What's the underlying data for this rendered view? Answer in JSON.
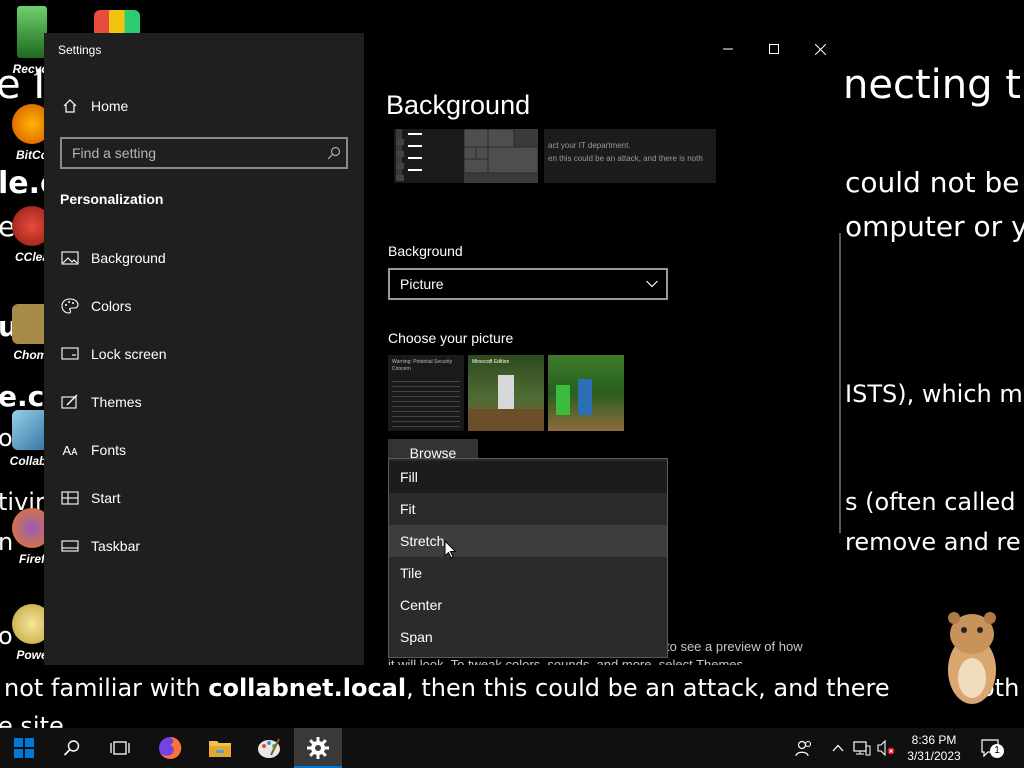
{
  "desktop": {
    "icons": [
      {
        "label": "Recycl"
      },
      {
        "label": "BitCo"
      },
      {
        "label": "CClea"
      },
      {
        "label": "Chomi"
      },
      {
        "label": "CollabS"
      },
      {
        "label": "Firef"
      },
      {
        "label": "Powe"
      }
    ],
    "wallpaper_lines": [
      "e IS",
      "necting t",
      "could not be",
      "le.c",
      "ed",
      "omputer or y",
      "u",
      "e.co",
      "ISTS), which m",
      "o",
      "tivir",
      "s (often called",
      "n",
      "remove and re",
      "o",
      "not familiar with ",
      "collabnet.local",
      ", then this could be an attack, and there ",
      "oth",
      "e site"
    ]
  },
  "window": {
    "title": "Settings",
    "home_label": "Home",
    "search_placeholder": "Find a setting",
    "section_title": "Personalization",
    "nav": [
      {
        "label": "Background",
        "icon": "picture-icon"
      },
      {
        "label": "Colors",
        "icon": "palette-icon"
      },
      {
        "label": "Lock screen",
        "icon": "lock-screen-icon"
      },
      {
        "label": "Themes",
        "icon": "brush-icon"
      },
      {
        "label": "Fonts",
        "icon": "fonts-icon"
      },
      {
        "label": "Start",
        "icon": "start-icon"
      },
      {
        "label": "Taskbar",
        "icon": "taskbar-icon"
      }
    ],
    "caption_buttons": [
      "minimize",
      "maximize",
      "close"
    ]
  },
  "main": {
    "page_title": "Background",
    "preview_text_1": "act your IT department.",
    "preview_text_2": "en this could be an attack, and there is noth",
    "background_label": "Background",
    "background_value": "Picture",
    "choose_label": "Choose your picture",
    "thumb1_title": "Warning: Potential Security Concern",
    "thumb2_title": "Minecraft Edition",
    "browse_label": "Browse",
    "fit_options": [
      "Fill",
      "Fit",
      "Stretch",
      "Tile",
      "Center",
      "Span"
    ],
    "fit_selected": "Fill",
    "fit_hover": "Stretch",
    "desc_line1": "to see a preview of how",
    "desc_line2": "it will look. To tweak colors, sounds, and more, select Themes."
  },
  "taskbar": {
    "time": "8:36 PM",
    "date": "3/31/2023",
    "notification_count": "1",
    "accent": "#0078d7"
  }
}
